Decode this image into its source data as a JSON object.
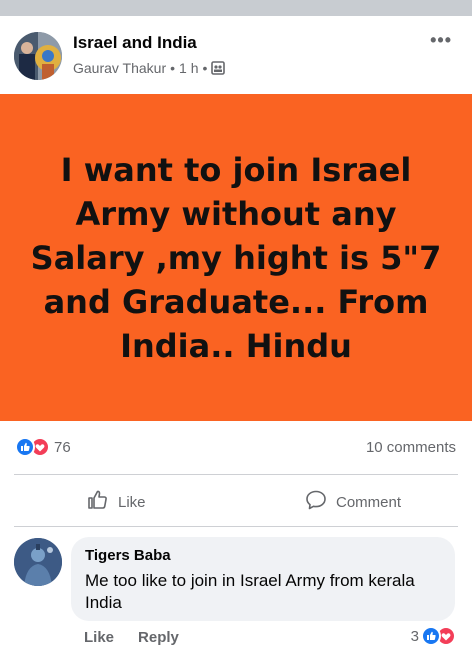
{
  "group": {
    "name": "Israel and India"
  },
  "post": {
    "author": "Gaurav Thakur",
    "separator": "•",
    "time": "1 h",
    "more_label": "•••",
    "text": "I want to join Israel Army without any Salary ,my hight is 5\"7 and Graduate... From India.. Hindu",
    "background_color": "#fa6322",
    "reaction_count": "76",
    "comments_count": "10 comments"
  },
  "actions": {
    "like_label": "Like",
    "comment_label": "Comment"
  },
  "comment": {
    "author": "Tigers Baba",
    "text": "Me too like to join in Israel Army from kerala India",
    "like_label": "Like",
    "reply_label": "Reply",
    "reaction_count": "3"
  },
  "colors": {
    "like_blue": "#1877f2",
    "love_red": "#f33e58",
    "muted": "#65676b"
  },
  "icons": [
    "audience-icon",
    "more-options-icon",
    "like-reaction-icon",
    "love-reaction-icon",
    "thumbs-up-icon",
    "comment-icon"
  ]
}
